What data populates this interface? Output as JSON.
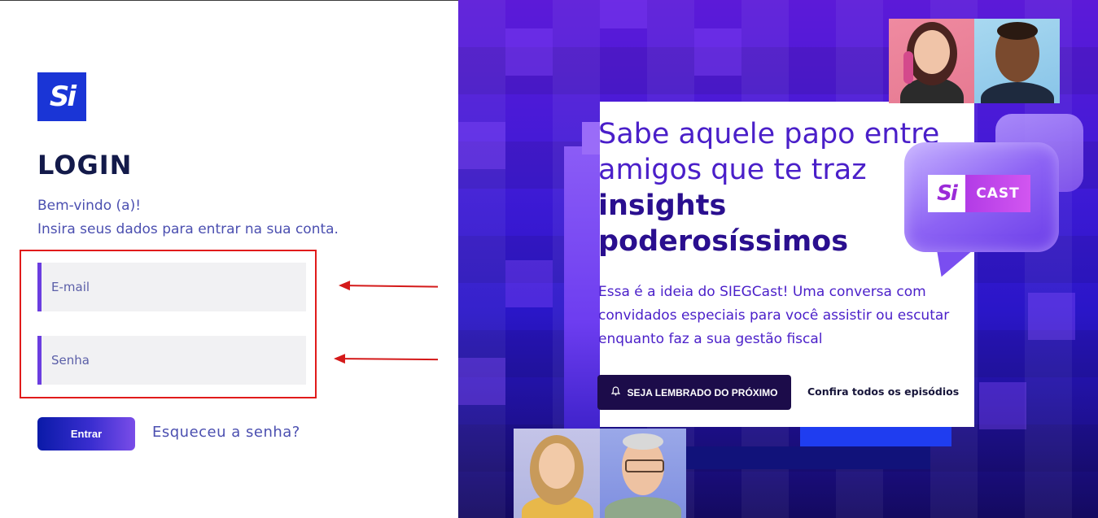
{
  "logo": {
    "text": "Si"
  },
  "login": {
    "title": "LOGIN",
    "welcome_line1": "Bem-vindo (a)!",
    "welcome_line2": "Insira seus dados para entrar na sua conta.",
    "email_placeholder": "E-mail",
    "password_placeholder": "Senha",
    "submit_label": "Entrar",
    "forgot_label": "Esqueceu a senha?"
  },
  "promo": {
    "headline_line1": "Sabe aquele papo entre",
    "headline_line2": "amigos que te traz",
    "headline_bold1": "insights",
    "headline_bold2": "poderosíssimos",
    "description": "Essa é a ideia do SIEGCast! Uma conversa com convidados especiais para você assistir ou escutar enquanto faz a sua gestão fiscal",
    "remind_button": "SEJA LEMBRADO DO PRÓXIMO",
    "episodes_link": "Confira todos os episódios",
    "badge_si": "Si",
    "badge_cast": "CAST"
  },
  "icons": {
    "bell": "bell-icon"
  },
  "colors": {
    "accent": "#6b3de0",
    "annotation": "#e11b1b",
    "brand_blue": "#1a35d6",
    "promo_text": "#4a1fc9"
  }
}
